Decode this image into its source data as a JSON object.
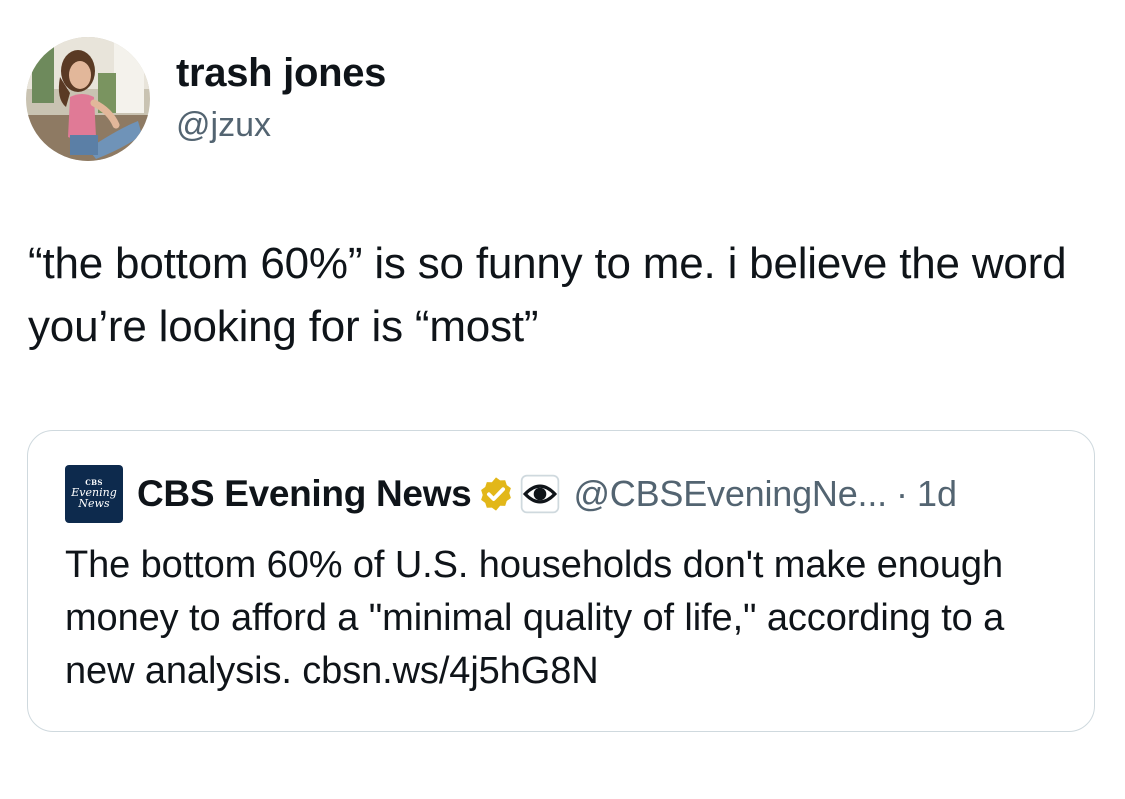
{
  "tweet": {
    "author_name": "trash jones",
    "author_handle": "@jzux",
    "text": "“the bottom 60%” is so funny to me. i believe the word you’re looking for is “most”"
  },
  "quote": {
    "logo_text": [
      "CBS",
      "Evening",
      "News"
    ],
    "author_name": "CBS Evening News",
    "author_handle": "@CBSEveningNe...",
    "separator": "·",
    "time": "1d",
    "text": "The bottom 60% of U.S. households don't make enough money to afford a \"minimal quality of life,\" according to a new analysis. cbsn.ws/4j5hG8N"
  },
  "icons": {
    "verified": "verified-badge-icon",
    "affiliate": "cbs-eye-affiliate-icon"
  },
  "colors": {
    "text": "#0f1419",
    "secondary": "#536471",
    "border": "#cfd9de",
    "verified_gold": "#e2b719",
    "cbs_navy": "#0d2a4d"
  }
}
